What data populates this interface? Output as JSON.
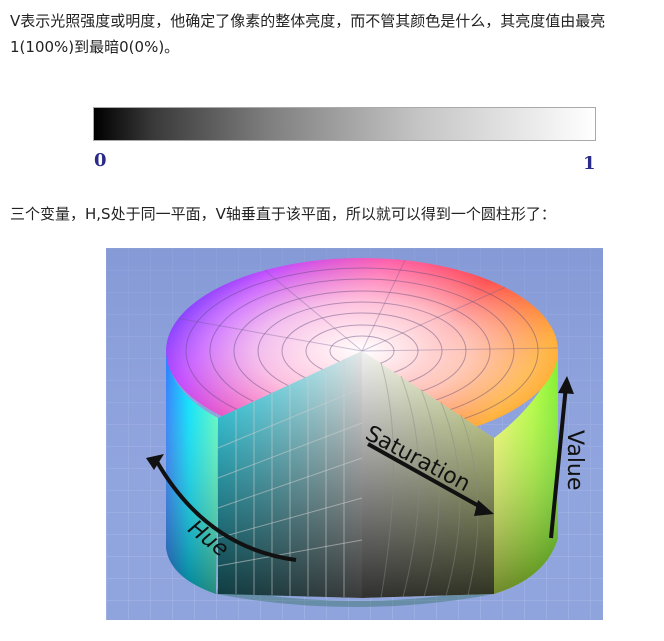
{
  "paragraphs": {
    "value_desc": "V表示光照强度或明度，他确定了像素的整体亮度，而不管其颜色是什么，其亮度值由最亮1(100%)到最暗0(0%)。",
    "cylinder_desc": "三个变量，H,S处于同一平面，V轴垂直于该平面，所以就可以得到一个圆柱形了："
  },
  "gradient_scale": {
    "min_label": "0",
    "max_label": "1"
  },
  "hsv_figure": {
    "hue_label": "Hue",
    "saturation_label": "Saturation",
    "value_label": "Value"
  },
  "colors": {
    "background_blue": "#8fa3dd",
    "scale_label": "#2a2a8a",
    "text": "#222222"
  }
}
